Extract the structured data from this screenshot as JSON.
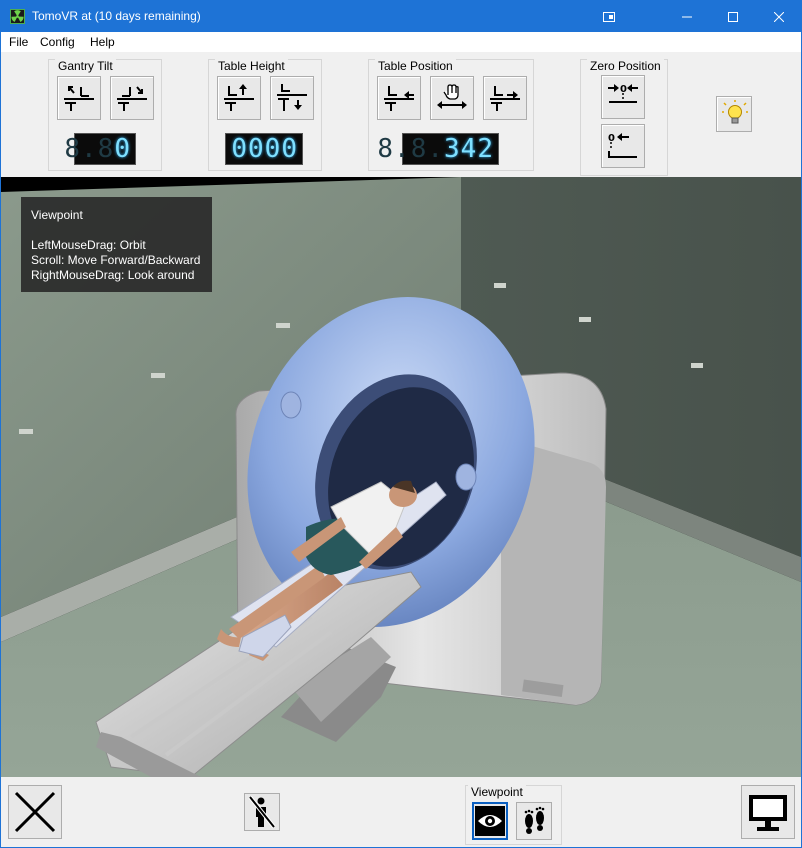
{
  "window": {
    "title": "TomoVR at  (10 days remaining)",
    "accent_color": "#1e73d6",
    "icon": "radiation-icon"
  },
  "menu": {
    "file": "File",
    "config": "Config",
    "help": "Help"
  },
  "toolbar": {
    "gantry_tilt": {
      "label": "Gantry Tilt",
      "readout": "0",
      "readout_ghost": "8.8",
      "buttons": [
        "tilt-left-icon",
        "tilt-right-icon"
      ]
    },
    "table_height": {
      "label": "Table Height",
      "readout": "0000",
      "buttons": [
        "table-up-icon",
        "table-down-icon"
      ]
    },
    "table_position": {
      "label": "Table Position",
      "readout": "342",
      "readout_ghost": "8.8.",
      "buttons": [
        "table-in-icon",
        "hand-drag-icon",
        "table-out-icon"
      ]
    },
    "zero_position": {
      "label": "Zero Position",
      "buttons": [
        "zero-table-position-icon",
        "zero-all-icon"
      ]
    },
    "light_button": "lightbulb-icon"
  },
  "viewport": {
    "help": {
      "title": "Viewpoint",
      "lines": [
        "LeftMouseDrag: Orbit",
        "Scroll: Move Forward/Backward",
        "RightMouseDrag: Look around"
      ]
    }
  },
  "bottombar": {
    "exit": "close-x-icon",
    "patient_toggle": "no-patient-icon",
    "viewpoint": {
      "label": "Viewpoint",
      "modes": [
        "eye-icon",
        "footprints-icon"
      ],
      "selected": "eye-icon"
    },
    "display": "monitor-icon"
  }
}
